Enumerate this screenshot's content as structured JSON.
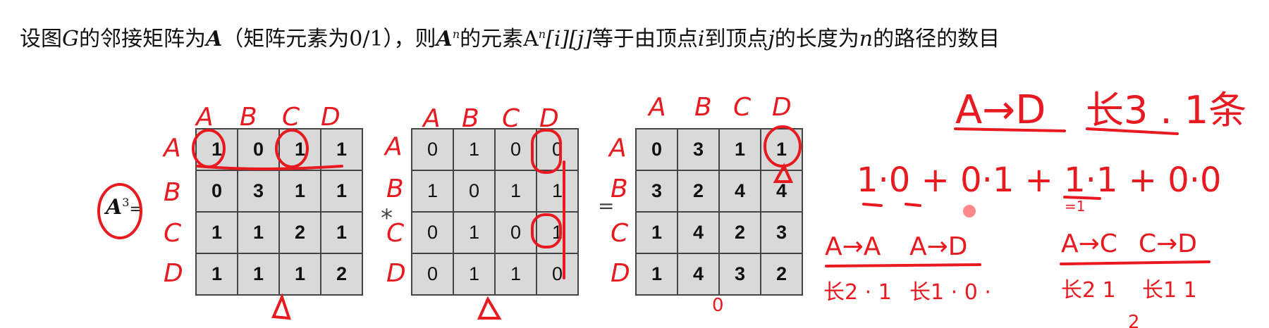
{
  "headline": {
    "pre": "设图",
    "g": "G",
    "mid1": "的邻接矩阵为",
    "a": "A",
    "mid2": "（矩阵元素为0/1），则",
    "an_base": "A",
    "an_sup": "n",
    "mid3": "的元素",
    "elem_base": "A",
    "elem_sup": "n",
    "idx1": "[i][j]",
    "mid4": "等于由顶点",
    "vi": "i",
    "mid5": "到顶点",
    "vj": "j",
    "mid6": "的长度为",
    "vn": "n",
    "mid7": "的路径的数目"
  },
  "equation": {
    "lhs_base": "A",
    "lhs_sup": "3",
    "equals": "=",
    "times": "*",
    "equals2": "="
  },
  "matrix_a2": [
    [
      "1",
      "0",
      "1",
      "1"
    ],
    [
      "0",
      "3",
      "1",
      "1"
    ],
    [
      "1",
      "1",
      "2",
      "1"
    ],
    [
      "1",
      "1",
      "1",
      "2"
    ]
  ],
  "matrix_a": [
    [
      "0",
      "1",
      "0",
      "0"
    ],
    [
      "1",
      "0",
      "1",
      "1"
    ],
    [
      "0",
      "1",
      "0",
      "1"
    ],
    [
      "0",
      "1",
      "1",
      "0"
    ]
  ],
  "matrix_a3": [
    [
      "0",
      "3",
      "1",
      "1"
    ],
    [
      "3",
      "2",
      "4",
      "4"
    ],
    [
      "1",
      "4",
      "2",
      "3"
    ],
    [
      "1",
      "4",
      "3",
      "2"
    ]
  ],
  "annotations": {
    "col_labels": [
      "A",
      "B",
      "C",
      "D"
    ],
    "row_labels": [
      "A",
      "B",
      "C",
      "D"
    ],
    "path_title": "A→D",
    "path_len": "长3 . 1条",
    "calc": "1·0 + 0·1 + 1·1 + 0·0",
    "under_a": "=1",
    "aa": "A→A",
    "ad": "A→D",
    "ac": "A→C",
    "cd": "C→D",
    "aa_len": "长2 · 1",
    "ad_len": "长1 · 0 ·",
    "ac_len": "长2 1",
    "cd_len": "长1 1",
    "delta": "Δ",
    "circle_digit": "0",
    "two": "2"
  },
  "colors": {
    "ink": "#e8191f",
    "cell": "#d9d9d9",
    "text": "#111111"
  }
}
